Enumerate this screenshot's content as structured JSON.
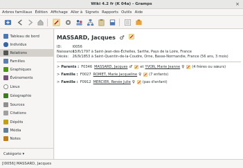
{
  "window": {
    "title": "Wiki 4.2 fr (K 04a) - Gramps",
    "close_glyph": "×"
  },
  "menu": [
    "Arbres familiaux",
    "Édition",
    "Affichage",
    "Aller à",
    "Signets",
    "Rapports",
    "Outils",
    "Aide"
  ],
  "toolbar_icons": [
    "add-icon",
    "back-icon",
    "forward-icon",
    "home-icon",
    "edit-icon",
    "settings-icon",
    "people-icon",
    "tree-icon",
    "clipboard-icon",
    "book-icon",
    "list-icon",
    "tools-icon"
  ],
  "sidebar": {
    "items": [
      {
        "label": "Tableau de bord",
        "icon": "dashboard-icon",
        "color": "#4a78b5"
      },
      {
        "label": "Individus",
        "icon": "person-icon",
        "color": "#3465a4"
      },
      {
        "label": "Relations",
        "icon": "relationships-icon",
        "color": "#555753",
        "active": true
      },
      {
        "label": "Familles",
        "icon": "family-icon",
        "color": "#5c7fb1"
      },
      {
        "label": "Graphiques",
        "icon": "charts-icon",
        "color": "#4e9a06"
      },
      {
        "label": "Événements",
        "icon": "events-icon",
        "color": "#75507b"
      },
      {
        "label": "Lieux",
        "icon": "places-icon",
        "color": "#888a85"
      },
      {
        "label": "Géographie",
        "icon": "geography-icon",
        "color": "#3a7f1c"
      },
      {
        "label": "Sources",
        "icon": "sources-icon",
        "color": "#8f8f8f"
      },
      {
        "label": "Citations",
        "icon": "citations-icon",
        "color": "#a0a0a0"
      },
      {
        "label": "Dépôts",
        "icon": "repositories-icon",
        "color": "#c4a000"
      },
      {
        "label": "Média",
        "icon": "media-icon",
        "color": "#5f7f9f"
      },
      {
        "label": "Notes",
        "icon": "notes-icon",
        "color": "#c17d11"
      }
    ],
    "footer_label": "Catégorie ▾"
  },
  "person": {
    "name": "MASSARD, Jacques",
    "sex_symbol": "♂",
    "id_label": "ID:",
    "id": "I0056",
    "birth_label": "Naissance:",
    "birth": "13/6/1797 à Saint-Jean-des-Échelles, Sarthe, Pays de la Loire, France",
    "death_label": "Décès:",
    "death": "26/9/1853 à Saint-Quentin-de-la-Coudre, Orne, Basse-Normandie, France (56 ans, 3 mois)"
  },
  "relations": [
    {
      "label": "Parents :",
      "id": "F0346",
      "first": "MASSARD, Jacques",
      "first_sym": "♂",
      "joiner": "et",
      "second": "YVON, Marie Jeanne",
      "second_sym": "♀",
      "note": "(4 frères ou sœurs)"
    },
    {
      "label": "Famille :",
      "id": "F0027",
      "first": "ROMET, Marie Jacqueline",
      "first_sym": "♀",
      "joiner": "",
      "second": "",
      "second_sym": "",
      "note": "(7 enfants)"
    },
    {
      "label": "Famille :",
      "id": "F0912",
      "first": "MERCIER, Renée Julie",
      "first_sym": "♀",
      "joiner": "",
      "second": "",
      "second_sym": "",
      "note": "(pas d'enfant)"
    }
  ],
  "status": {
    "text": "[I0056] MASSARD, Jacques"
  }
}
